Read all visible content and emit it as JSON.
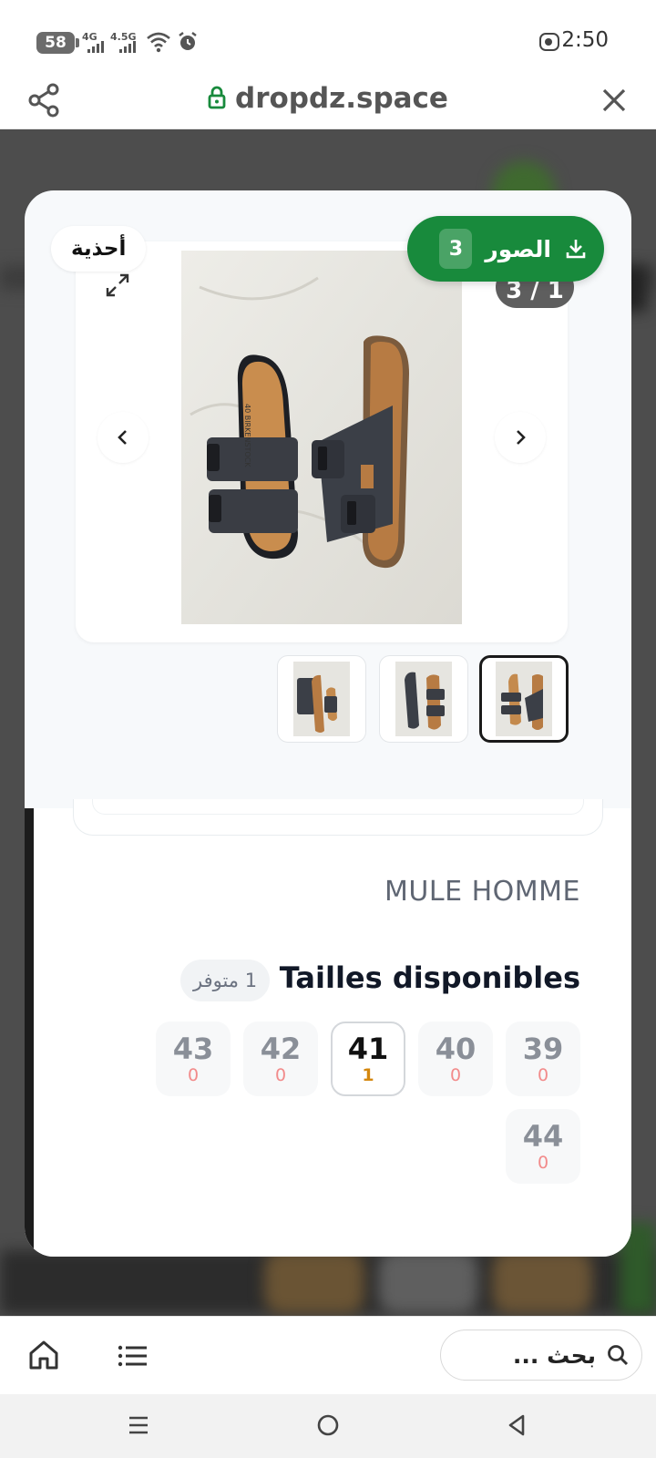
{
  "status_bar": {
    "battery": "58",
    "network_1": "4G",
    "network_2": "4.5G",
    "time": "2:50",
    "icons": [
      "wifi-icon",
      "alarm-icon",
      "screen-record-icon"
    ]
  },
  "browser": {
    "url": "dropdz.space",
    "icons": [
      "share-icon",
      "lock-icon",
      "close-icon"
    ]
  },
  "modal": {
    "category": "أحذية",
    "photos_button": {
      "label": "الصور",
      "count": "3",
      "icon": "download-icon"
    },
    "viewer": {
      "counter": "3 / 1",
      "prev_icon": "chevron-left-icon",
      "next_icon": "chevron-right-icon",
      "expand_icon": "expand-icon"
    },
    "thumbnails": [
      {
        "name": "thumb-1",
        "active": false
      },
      {
        "name": "thumb-2",
        "active": false
      },
      {
        "name": "thumb-3",
        "active": true
      }
    ],
    "product_name": "MULE HOMME",
    "sizes": {
      "title": "Tailles disponibles",
      "available": "1 متوفر",
      "items": [
        {
          "size": "39",
          "qty": "0",
          "selected": false
        },
        {
          "size": "40",
          "qty": "0",
          "selected": false
        },
        {
          "size": "41",
          "qty": "1",
          "selected": true
        },
        {
          "size": "42",
          "qty": "0",
          "selected": false
        },
        {
          "size": "43",
          "qty": "0",
          "selected": false
        },
        {
          "size": "44",
          "qty": "0",
          "selected": false
        }
      ]
    }
  },
  "bottom_bar": {
    "search_placeholder": "بحث ...",
    "icons": [
      "home-icon",
      "list-icon",
      "search-icon"
    ]
  },
  "colors": {
    "accent_green": "#188a3c",
    "selected_qty": "#d4870e",
    "zero_qty": "#f28b8b"
  }
}
